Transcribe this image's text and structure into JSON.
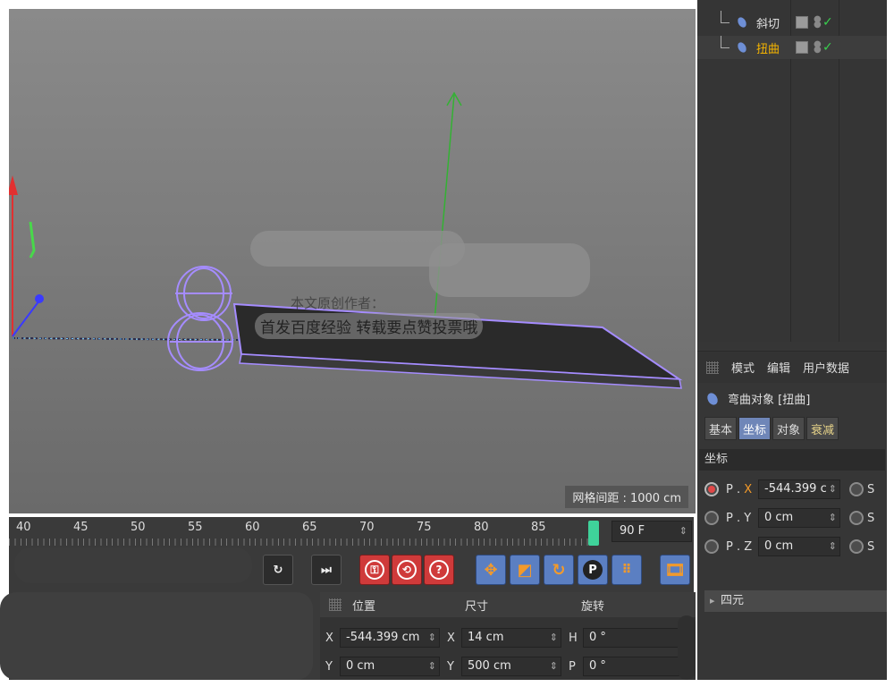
{
  "viewport": {
    "watermark_top": "本文原创作者：",
    "watermark": "首发百度经验  转载要点赞投票哦",
    "grid_spacing": "网格间距 : 1000 cm"
  },
  "object_list": {
    "items": [
      {
        "name": "斜切",
        "highlighted": false
      },
      {
        "name": "扭曲",
        "highlighted": true
      }
    ]
  },
  "attributes": {
    "menu": [
      "模式",
      "编辑",
      "用户数据"
    ],
    "object_title": "弯曲对象 [扭曲]",
    "tabs": [
      "基本",
      "坐标",
      "对象",
      "衰减"
    ],
    "active_tab": "坐标",
    "section": "坐标",
    "rows": [
      {
        "label": "P",
        "axis": "X",
        "value": "-544.399 c",
        "s": "S"
      },
      {
        "label": "P",
        "axis": "Y",
        "value": "0 cm",
        "s": "S"
      },
      {
        "label": "P",
        "axis": "Z",
        "value": "0 cm",
        "s": "S"
      }
    ],
    "folded_section": "四元"
  },
  "timeline": {
    "ticks": [
      "40",
      "45",
      "50",
      "55",
      "60",
      "65",
      "70",
      "75",
      "80",
      "85"
    ],
    "end_frame": "90 F"
  },
  "toolbar": {
    "icons": [
      "loop-icon",
      "goto-end-icon",
      "keyframe-record-icon",
      "autokey-icon",
      "keyframe-help-icon",
      "move-key-icon",
      "scale-key-icon",
      "rotate-key-icon",
      "param-key-icon",
      "pla-key-icon",
      "film-icon"
    ]
  },
  "coord_manager": {
    "headers": [
      "位置",
      "尺寸",
      "旋转"
    ],
    "rows": [
      {
        "pos_label": "X",
        "pos_value": "-544.399 cm",
        "size_label": "X",
        "size_value": "14 cm",
        "rot_label": "H",
        "rot_value": "0 °"
      },
      {
        "pos_label": "Y",
        "pos_value": "0 cm",
        "size_label": "Y",
        "size_value": "500 cm",
        "rot_label": "P",
        "rot_value": "0 °"
      }
    ]
  },
  "colors": {
    "accent_blue": "#6f86b8",
    "highlight_orange": "#f5b400",
    "check_green": "#38d04d",
    "deformer_purple": "#a58cff"
  }
}
